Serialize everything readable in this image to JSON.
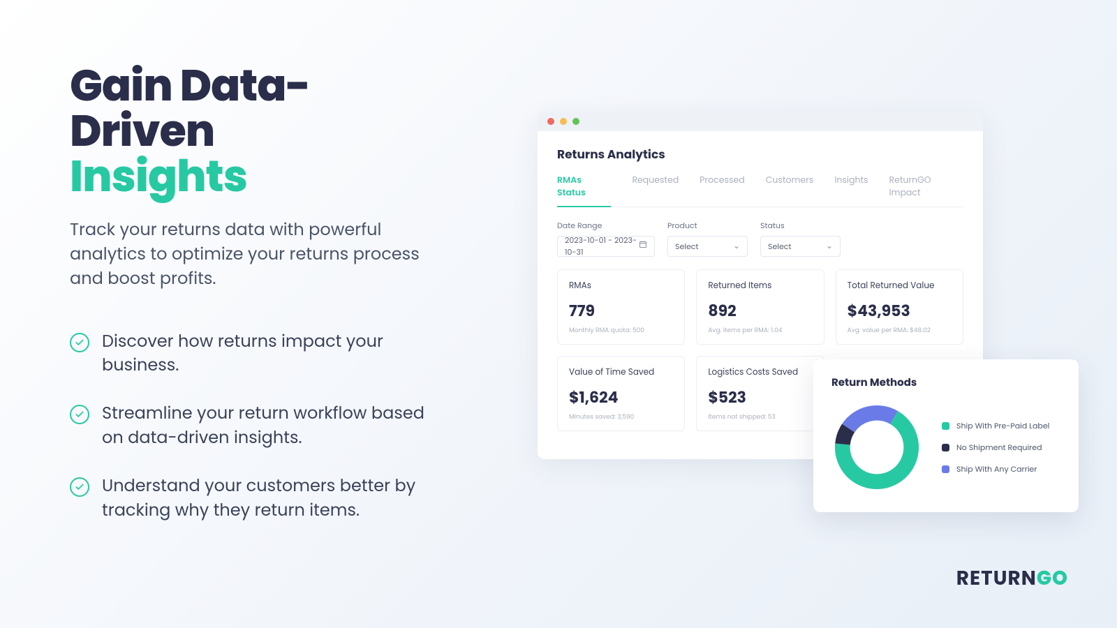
{
  "headline": {
    "line1": "Gain Data-Driven",
    "line2": "Insights"
  },
  "subhead": "Track your returns data with powerful analytics to optimize your returns process and boost profits.",
  "bullets": [
    "Discover how returns impact your business.",
    "Streamline your return workflow based on data-driven insights.",
    "Understand your customers better by tracking why they return items."
  ],
  "app": {
    "title": "Returns Analytics",
    "tabs": [
      "RMAs Status",
      "Requested",
      "Processed",
      "Customers",
      "Insights",
      "ReturnGO Impact"
    ],
    "active_tab": 0,
    "filters": {
      "date_label": "Date Range",
      "date_value": "2023-10-01 - 2023-10-31",
      "product_label": "Product",
      "product_value": "Select",
      "status_label": "Status",
      "status_value": "Select"
    },
    "cards": [
      {
        "title": "RMAs",
        "value": "779",
        "sub": "Monthly RMA quota: 500"
      },
      {
        "title": "Returned Items",
        "value": "892",
        "sub": "Avg. items per RMA: 1.04"
      },
      {
        "title": "Total Returned Value",
        "value": "$43,953",
        "sub": "Avg. value per RMA: $48.02"
      },
      {
        "title": "Value of Time Saved",
        "value": "$1,624",
        "sub": "Minutes saved: 3,590"
      },
      {
        "title": "Logistics Costs Saved",
        "value": "$523",
        "sub": "Items not shipped: 53"
      }
    ]
  },
  "donut": {
    "title": "Return Methods",
    "legend": [
      {
        "label": "Ship With Pre-Paid Label",
        "color": "#27c9a3"
      },
      {
        "label": "No Shipment Required",
        "color": "#2a2e4a"
      },
      {
        "label": "Ship With Any Carrier",
        "color": "#6a7be8"
      }
    ]
  },
  "brand": {
    "p1": "RETURN",
    "p2": "GO"
  },
  "chart_data": {
    "type": "pie",
    "title": "Return Methods",
    "series": [
      {
        "name": "Ship With Pre-Paid Label",
        "value": 68,
        "color": "#27c9a3"
      },
      {
        "name": "No Shipment Required",
        "value": 8,
        "color": "#2a2e4a"
      },
      {
        "name": "Ship With Any Carrier",
        "value": 24,
        "color": "#6a7be8"
      }
    ],
    "note": "Values are approximate percentages estimated from arc angles; donut inner radius ~55% of outer."
  }
}
